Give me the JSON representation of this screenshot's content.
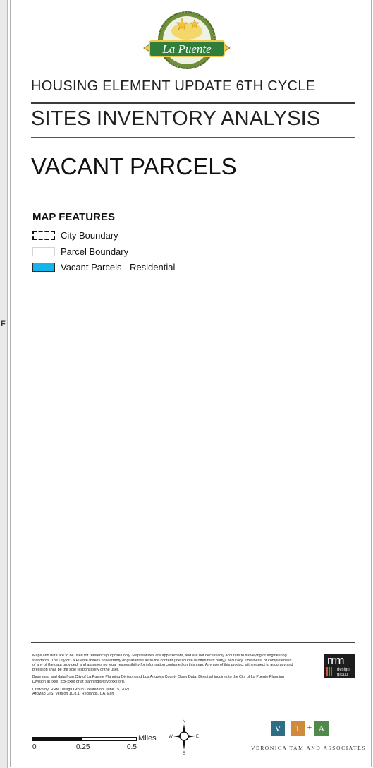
{
  "left_mark": "F",
  "logo": {
    "text": "La Puente"
  },
  "header": {
    "subtitle": "HOUSING ELEMENT UPDATE 6TH CYCLE",
    "title": "SITES INVENTORY ANALYSIS",
    "map_name": "VACANT PARCELS"
  },
  "legend": {
    "title": "MAP FEATURES",
    "items": [
      {
        "label": "City Boundary",
        "symbol": "dashed-outline",
        "color": "#111111"
      },
      {
        "label": "Parcel Boundary",
        "symbol": "thin-outline",
        "color": "#d4d4d4"
      },
      {
        "label": "Vacant Parcels - Residential",
        "symbol": "filled",
        "color": "#14b5ea"
      }
    ]
  },
  "disclaimer": {
    "p1": "Maps and data are to be used for reference purposes only. Map features are approximate, and are not necessarily accurate to surveying or engineering standards. The City of La Puente makes no warranty or guarantee as to the content (the source is often third party), accuracy, timeliness, or completeness of any of the data provided, and assumes no legal responsibility for information contained on this map. Any use of this product with respect to accuracy and precision shall be the sole responsibility of the user.",
    "p2": "Base map and data from City of La Puente Planning Division and Los Angeles County Open Data. Direct all inquires to the City of La Puente Planning Division at (xxx) xxx-xxxx or at planning@cityofxxx.org.",
    "p3a": "Drawn by: RRM Design Group Created on: June 15, 2021.",
    "p3b": "ArcMap GIS. Version 10.8.1. Redlands, CA. Esri"
  },
  "rrm_logo": {
    "big": "rrm",
    "line1": "design",
    "line2": "group"
  },
  "scale_bar": {
    "labels": [
      "0",
      "0.25",
      "0.5"
    ],
    "unit": "Miles"
  },
  "compass": {
    "n": "N",
    "s": "S",
    "e": "E",
    "w": "W"
  },
  "vta_logo": {
    "letters": [
      "V",
      "T",
      "A"
    ],
    "plus": "+",
    "colors": [
      "#2f6f86",
      "#d08a3c",
      "#4f8a4a"
    ],
    "name": "VERONICA TAM AND ASSOCIATES"
  }
}
